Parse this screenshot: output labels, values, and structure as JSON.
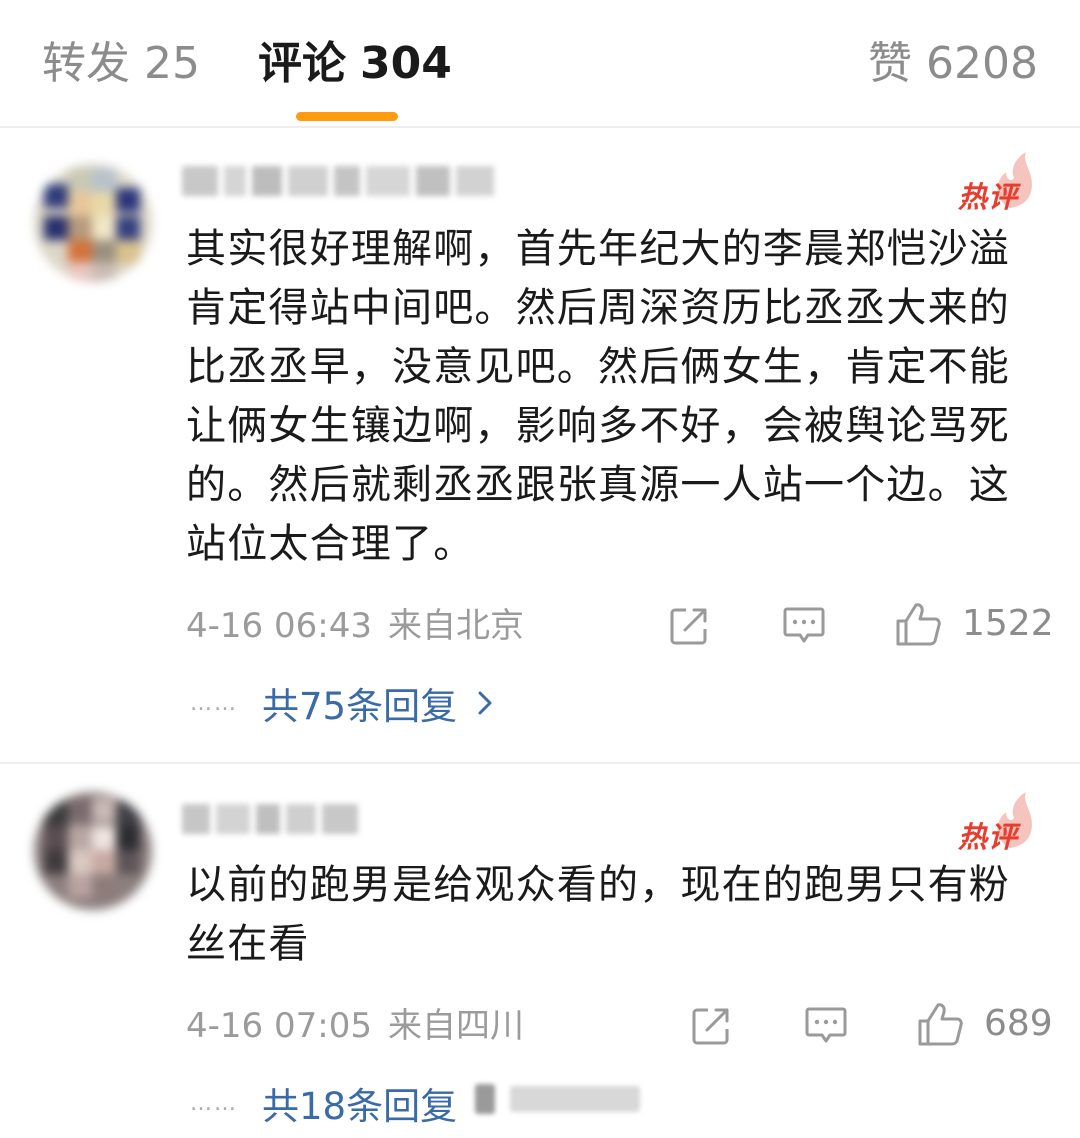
{
  "tabs": {
    "repost": {
      "label": "转发",
      "count": "25"
    },
    "comments": {
      "label": "评论",
      "count": "304"
    },
    "likes": {
      "label": "赞",
      "count": "6208"
    }
  },
  "comments": [
    {
      "hot_label": "热评",
      "text": "其实很好理解啊，首先年纪大的李晨郑恺沙溢肯定得站中间吧。然后周深资历比丞丞大来的比丞丞早，没意见吧。然后俩女生，肯定不能让俩女生镶边啊，影响多不好，会被舆论骂死的。然后就剩丞丞跟张真源一人站一个边。这站位太合理了。",
      "date": "4-16 06:43",
      "location": "来自北京",
      "likes": "1522",
      "replies_label": "共75条回复",
      "replies_dots": "……"
    },
    {
      "hot_label": "热评",
      "text": "以前的跑男是给观众看的，现在的跑男只有粉丝在看",
      "date": "4-16 07:05",
      "location": "来自四川",
      "likes": "689",
      "replies_label": "共18条回复",
      "replies_dots": "……"
    }
  ],
  "colors": {
    "tab_indicator": "#ff9b0f",
    "hot_red": "#e73d2f",
    "reply_link": "#3a6aa8",
    "meta_gray": "#9b9b9b"
  },
  "icons": [
    "repost-icon",
    "comment-icon",
    "like-icon",
    "flame-icon",
    "chevron-right-icon"
  ]
}
